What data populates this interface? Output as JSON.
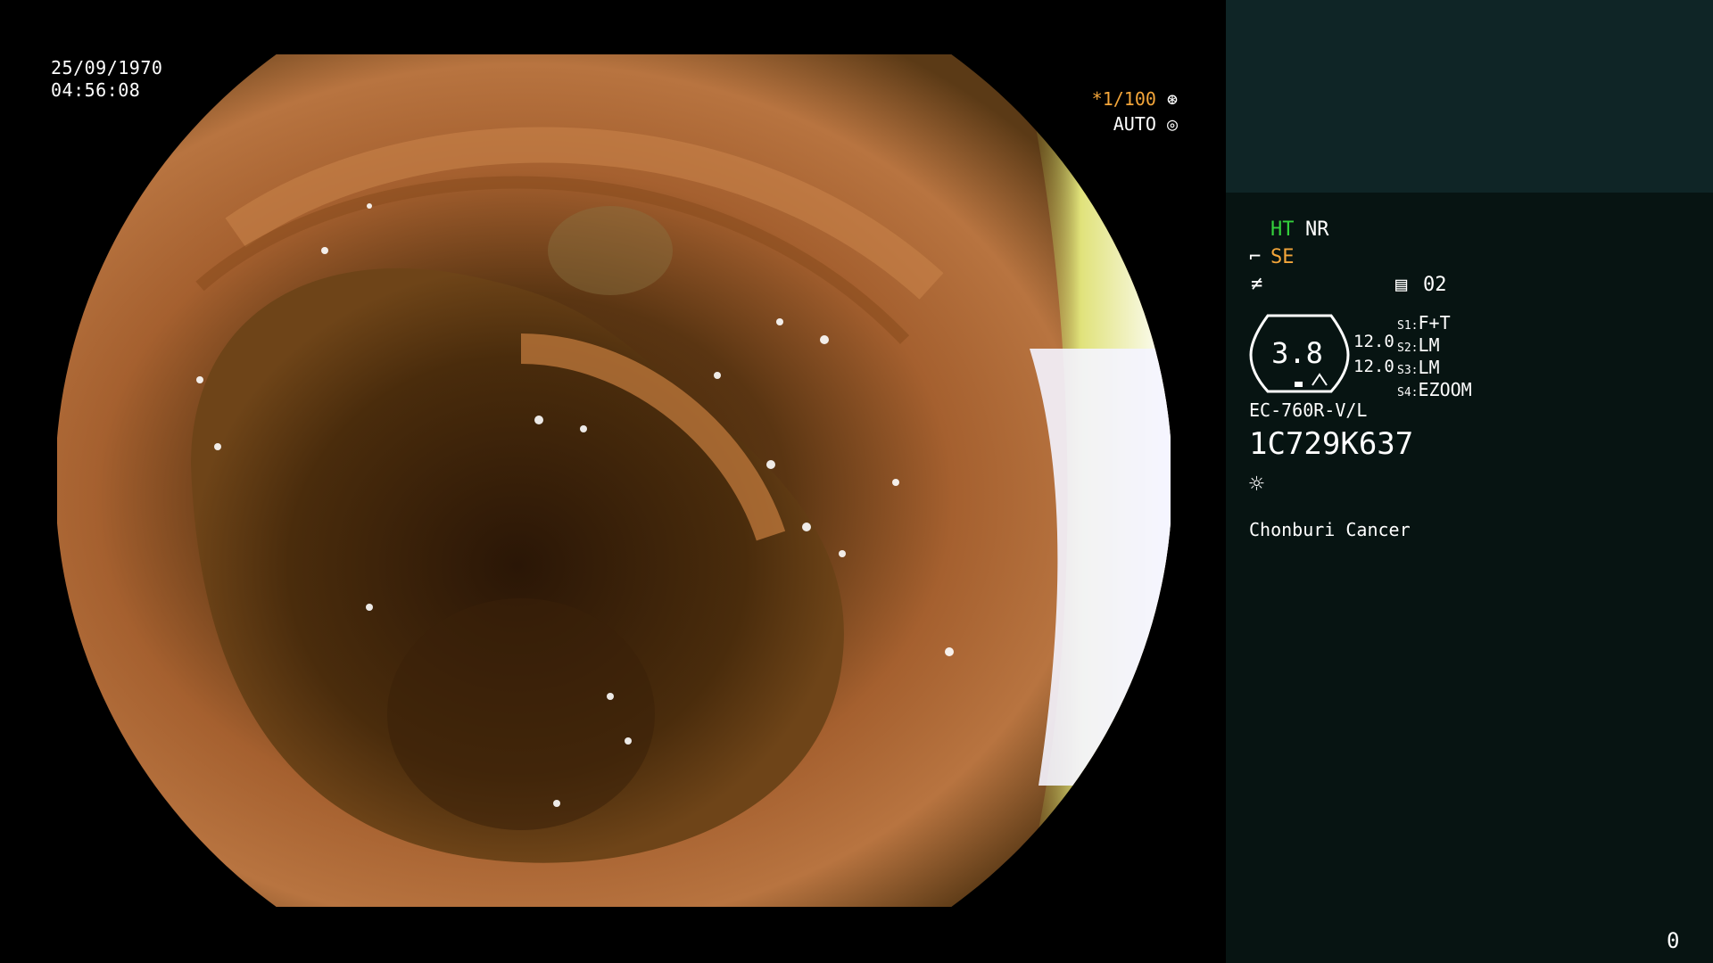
{
  "overlay": {
    "date": "25/09/1970",
    "time": "04:56:08",
    "shutter": "*1/100",
    "exposure_mode": "AUTO",
    "shutter_icon": "aperture-icon",
    "auto_icon": "iris-icon"
  },
  "panel": {
    "ht": "HT",
    "nr": "NR",
    "se": "SE",
    "se_icon": "structure-enhancement-icon",
    "color_icon": "color-tone-icon",
    "memory_icon": "memory-card-icon",
    "memory_count": "02",
    "gauge_value": "3.8",
    "gauge_top": "12.0",
    "gauge_bottom": "12.0",
    "switches": [
      {
        "key": "S1:",
        "value": "F+T"
      },
      {
        "key": "S2:",
        "value": "LM"
      },
      {
        "key": "S3:",
        "value": "LM"
      },
      {
        "key": "S4:",
        "value": "EZOOM"
      }
    ],
    "scope_model": "EC-760R-V/L",
    "scope_serial": "1C729K637",
    "light_icon": "light-source-icon",
    "institution": "Chonburi Cancer",
    "counter": "0"
  },
  "colors": {
    "panel_top": "#0f2526",
    "panel_bottom": "#071412",
    "green": "#34d13c",
    "orange": "#f4a63a"
  }
}
